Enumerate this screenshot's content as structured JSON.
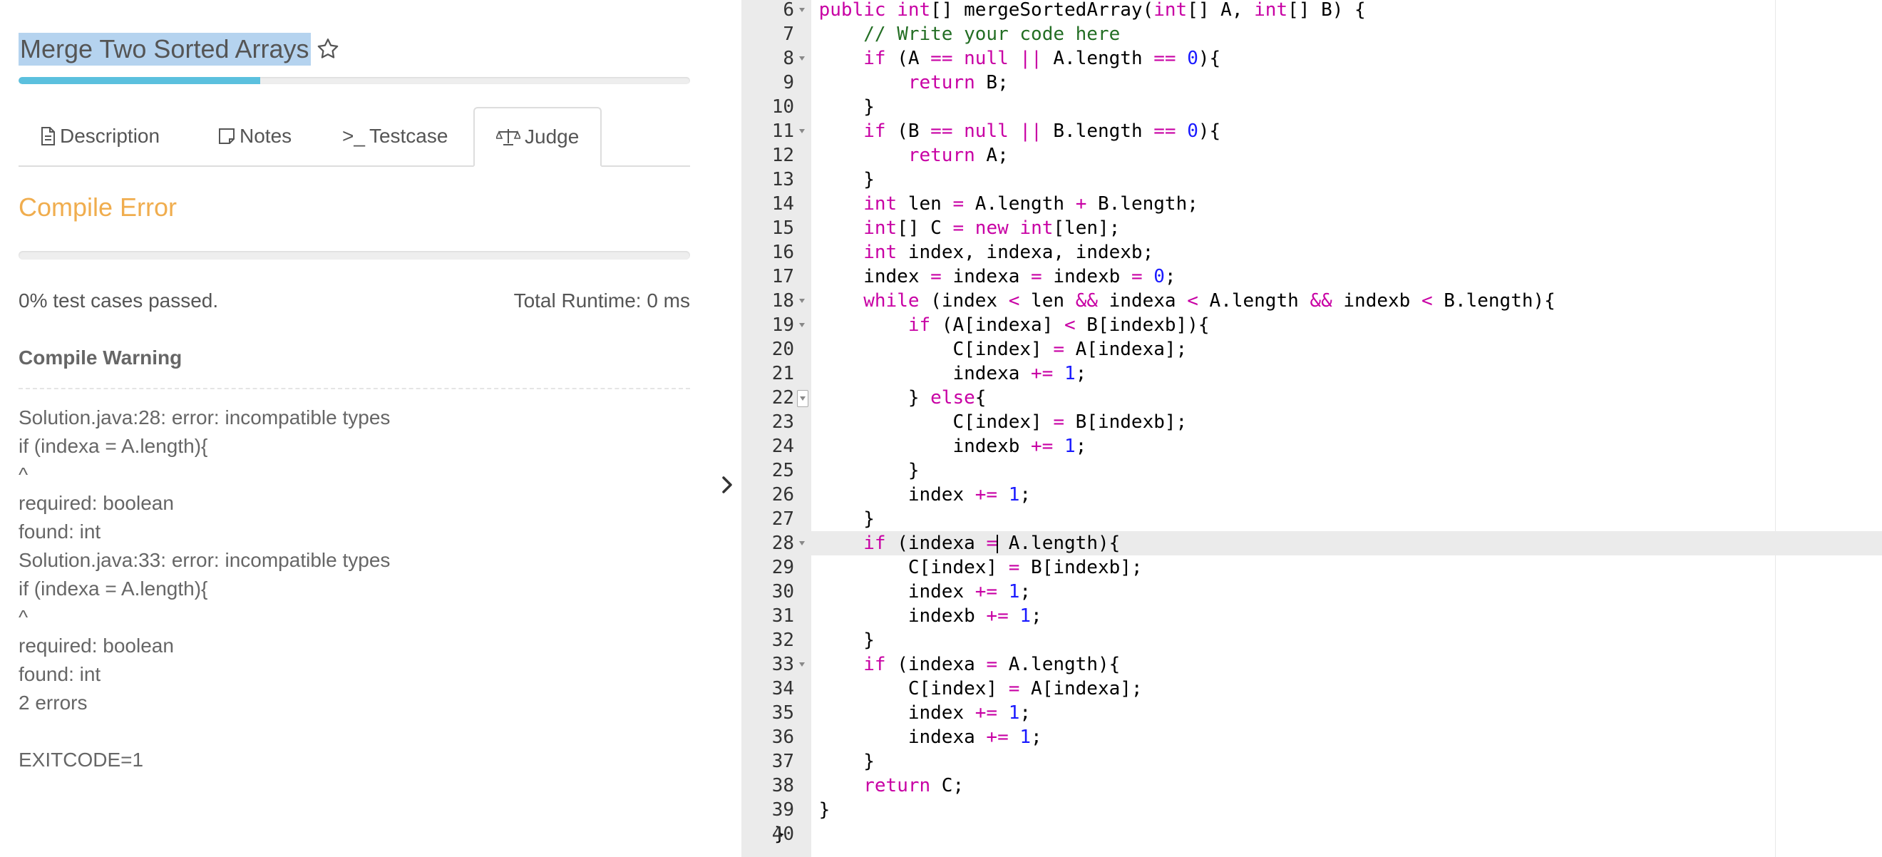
{
  "problem": {
    "title": "Merge Two Sorted Arrays",
    "progress_fraction": 0.36
  },
  "tabs": [
    {
      "label": "Description",
      "icon": "document-icon"
    },
    {
      "label": "Notes",
      "icon": "note-icon"
    },
    {
      "label": "Testcase",
      "icon": "terminal-icon",
      "prefix": ">_"
    },
    {
      "label": "Judge",
      "icon": "scale-icon",
      "active": true
    }
  ],
  "judge": {
    "status": "Compile Error",
    "passed": "0% test cases passed.",
    "runtime": "Total Runtime: 0 ms",
    "warning_heading": "Compile Warning",
    "messages": [
      "Solution.java:28: error: incompatible types",
      "if (indexa = A.length){",
      "^",
      "required: boolean",
      "found: int",
      "Solution.java:33: error: incompatible types",
      "if (indexa = A.length){",
      "^",
      "required: boolean",
      "found: int",
      "2 errors",
      "",
      "EXITCODE=1"
    ]
  },
  "colors": {
    "status": "#f0ad4e",
    "progress": "#5bc0de",
    "keyword": "#c800a4",
    "number": "#1a1aff",
    "comment": "#236e24"
  },
  "editor": {
    "active_line": 28,
    "lines": [
      {
        "n": 6,
        "fold": true,
        "code": "    public int[] mergeSortedArray(int[] A, int[] B) {"
      },
      {
        "n": 7,
        "fold": false,
        "code": "        // Write your code here"
      },
      {
        "n": 8,
        "fold": true,
        "code": "        if (A == null || A.length == 0){"
      },
      {
        "n": 9,
        "fold": false,
        "code": "            return B;"
      },
      {
        "n": 10,
        "fold": false,
        "code": "        }"
      },
      {
        "n": 11,
        "fold": true,
        "code": "        if (B == null || B.length == 0){"
      },
      {
        "n": 12,
        "fold": false,
        "code": "            return A;"
      },
      {
        "n": 13,
        "fold": false,
        "code": "        }"
      },
      {
        "n": 14,
        "fold": false,
        "code": "        int len = A.length + B.length;"
      },
      {
        "n": 15,
        "fold": false,
        "code": "        int[] C = new int[len];"
      },
      {
        "n": 16,
        "fold": false,
        "code": "        int index, indexa, indexb;"
      },
      {
        "n": 17,
        "fold": false,
        "code": "        index = indexa = indexb = 0;"
      },
      {
        "n": 18,
        "fold": true,
        "code": "        while (index < len && indexa < A.length && indexb < B.length){"
      },
      {
        "n": 19,
        "fold": true,
        "code": "            if (A[indexa] < B[indexb]){"
      },
      {
        "n": 20,
        "fold": false,
        "code": "                C[index] = A[indexa];"
      },
      {
        "n": 21,
        "fold": false,
        "code": "                indexa += 1;"
      },
      {
        "n": 22,
        "fold": true,
        "boxed": true,
        "code": "            } else{"
      },
      {
        "n": 23,
        "fold": false,
        "code": "                C[index] = B[indexb];"
      },
      {
        "n": 24,
        "fold": false,
        "code": "                indexb += 1;"
      },
      {
        "n": 25,
        "fold": false,
        "code": "            }"
      },
      {
        "n": 26,
        "fold": false,
        "code": "            index += 1;"
      },
      {
        "n": 27,
        "fold": false,
        "code": "        }"
      },
      {
        "n": 28,
        "fold": true,
        "code": "        if (indexa = A.length){"
      },
      {
        "n": 29,
        "fold": false,
        "code": "            C[index] = B[indexb];"
      },
      {
        "n": 30,
        "fold": false,
        "code": "            index += 1;"
      },
      {
        "n": 31,
        "fold": false,
        "code": "            indexb += 1;"
      },
      {
        "n": 32,
        "fold": false,
        "code": "        }"
      },
      {
        "n": 33,
        "fold": true,
        "code": "        if (indexa = A.length){"
      },
      {
        "n": 34,
        "fold": false,
        "code": "            C[index] = A[indexa];"
      },
      {
        "n": 35,
        "fold": false,
        "code": "            index += 1;"
      },
      {
        "n": 36,
        "fold": false,
        "code": "            indexa += 1;"
      },
      {
        "n": 37,
        "fold": false,
        "code": "        }"
      },
      {
        "n": 38,
        "fold": false,
        "code": "        return C;"
      },
      {
        "n": 39,
        "fold": false,
        "code": "    }"
      },
      {
        "n": 40,
        "fold": false,
        "code": "}"
      }
    ]
  }
}
